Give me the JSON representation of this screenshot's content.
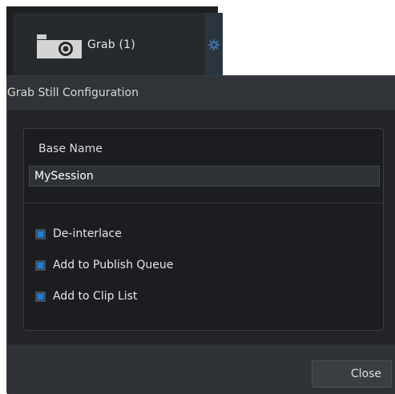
{
  "grab_button": {
    "label": "Grab (1)",
    "icon": "camera-icon",
    "settings_icon": "gear-icon"
  },
  "dialog": {
    "title": "Grab Still Configuration",
    "base_name": {
      "label": "Base Name",
      "value": "MySession"
    },
    "options": [
      {
        "label": "De-interlace",
        "checked": true
      },
      {
        "label": "Add to Publish Queue",
        "checked": true
      },
      {
        "label": "Add to Clip List",
        "checked": true
      }
    ],
    "close_label": "Close"
  },
  "colors": {
    "accent": "#1f7fd6",
    "panel": "#2a2d31",
    "group_bg": "#1b1d20"
  }
}
